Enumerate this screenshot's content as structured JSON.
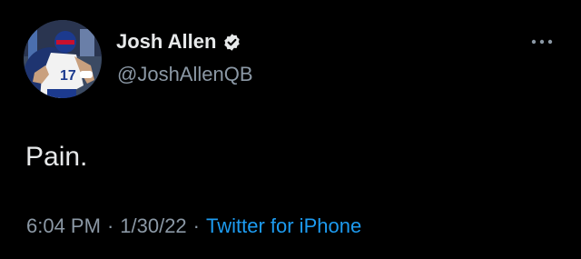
{
  "author": {
    "name": "Josh Allen",
    "handle": "@JoshAllenQB",
    "verified": true,
    "avatar_icon": "player-photo-avatar"
  },
  "menu": {
    "icon": "more-horizontal-icon"
  },
  "tweet": {
    "text": "Pain."
  },
  "meta": {
    "time": "6:04 PM",
    "date": "1/30/22",
    "separator": "·",
    "source": "Twitter for iPhone"
  },
  "colors": {
    "background": "#000000",
    "primary_text": "#e7e9ea",
    "secondary_text": "#8b98a5",
    "link": "#1d9bf0",
    "verified_badge": "#e7e9ea"
  }
}
